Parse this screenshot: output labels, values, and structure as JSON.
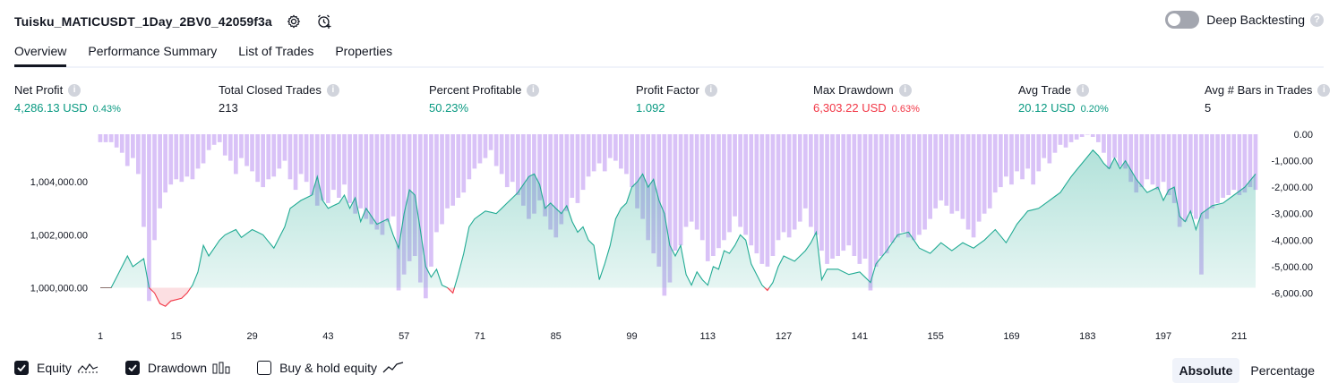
{
  "header": {
    "title": "Tuisku_MATICUSDT_1Day_2BV0_42059f3a",
    "deep_backtesting_label": "Deep Backtesting"
  },
  "tabs": [
    {
      "label": "Overview",
      "active": true
    },
    {
      "label": "Performance Summary",
      "active": false
    },
    {
      "label": "List of Trades",
      "active": false
    },
    {
      "label": "Properties",
      "active": false
    }
  ],
  "metrics": [
    {
      "label": "Net Profit",
      "value": "4,286.13 USD",
      "pct": "0.43%",
      "color": "green"
    },
    {
      "label": "Total Closed Trades",
      "value": "213",
      "pct": "",
      "color": "neutral"
    },
    {
      "label": "Percent Profitable",
      "value": "50.23%",
      "pct": "",
      "color": "green"
    },
    {
      "label": "Profit Factor",
      "value": "1.092",
      "pct": "",
      "color": "green"
    },
    {
      "label": "Max Drawdown",
      "value": "6,303.22 USD",
      "pct": "0.63%",
      "color": "red"
    },
    {
      "label": "Avg Trade",
      "value": "20.12 USD",
      "pct": "0.20%",
      "color": "green"
    },
    {
      "label": "Avg # Bars in Trades",
      "value": "5",
      "pct": "",
      "color": "neutral"
    }
  ],
  "legend": {
    "equity": {
      "label": "Equity",
      "checked": true
    },
    "drawdown": {
      "label": "Drawdown",
      "checked": true
    },
    "buy_hold": {
      "label": "Buy & hold equity",
      "checked": false
    }
  },
  "mode": {
    "absolute": "Absolute",
    "percentage": "Percentage",
    "active": "absolute"
  },
  "colors": {
    "equity_line": "#22ab94",
    "equity_fill": "#d7f0ea",
    "loss_line": "#f23645",
    "loss_fill": "#fcdfe2",
    "drawdown_bar": "#d9c2f7",
    "accent_green": "#089981",
    "accent_red": "#f23645"
  },
  "chart_data": {
    "type": "area",
    "x_ticks": [
      "1",
      "15",
      "29",
      "43",
      "57",
      "71",
      "85",
      "99",
      "113",
      "127",
      "141",
      "155",
      "169",
      "183",
      "197",
      "211"
    ],
    "y_left_ticks": [
      "1,000,000.00",
      "1,002,000.00",
      "1,004,000.00"
    ],
    "y_right_ticks": [
      "0.00",
      "-1,000.00",
      "-2,000.00",
      "-3,000.00",
      "-4,000.00",
      "-5,000.00",
      "-6,000.00"
    ],
    "y_left_range": [
      998800,
      1005800
    ],
    "y_right_range": [
      -7000,
      0
    ],
    "equity_keypoints": [
      [
        1,
        1000000
      ],
      [
        3,
        1000000
      ],
      [
        6,
        1001200
      ],
      [
        7,
        1000800
      ],
      [
        9,
        1001100
      ],
      [
        10,
        1000000
      ],
      [
        11,
        999800
      ],
      [
        12,
        999400
      ],
      [
        13,
        999300
      ],
      [
        14,
        999500
      ],
      [
        16,
        999600
      ],
      [
        17,
        999800
      ],
      [
        18,
        1000100
      ],
      [
        19,
        1000600
      ],
      [
        20,
        1001600
      ],
      [
        21,
        1001200
      ],
      [
        22,
        1001500
      ],
      [
        23,
        1001800
      ],
      [
        24,
        1002000
      ],
      [
        26,
        1002200
      ],
      [
        27,
        1001900
      ],
      [
        29,
        1002200
      ],
      [
        31,
        1002000
      ],
      [
        33,
        1001500
      ],
      [
        35,
        1002300
      ],
      [
        36,
        1003000
      ],
      [
        38,
        1003300
      ],
      [
        40,
        1003500
      ],
      [
        41,
        1004200
      ],
      [
        42,
        1003300
      ],
      [
        43,
        1003000
      ],
      [
        45,
        1003200
      ],
      [
        46,
        1003500
      ],
      [
        47,
        1003000
      ],
      [
        48,
        1003400
      ],
      [
        49,
        1002500
      ],
      [
        50,
        1003000
      ],
      [
        52,
        1002400
      ],
      [
        54,
        1002600
      ],
      [
        55,
        1002000
      ],
      [
        56,
        1001500
      ],
      [
        57,
        1002800
      ],
      [
        58,
        1003700
      ],
      [
        59,
        1003500
      ],
      [
        60,
        1002200
      ],
      [
        61,
        1000800
      ],
      [
        62,
        1000400
      ],
      [
        63,
        1000700
      ],
      [
        64,
        1000100
      ],
      [
        65,
        1000000
      ],
      [
        66,
        999800
      ],
      [
        67,
        1000500
      ],
      [
        68,
        1001300
      ],
      [
        69,
        1002300
      ],
      [
        70,
        1002600
      ],
      [
        72,
        1002900
      ],
      [
        74,
        1002800
      ],
      [
        76,
        1003200
      ],
      [
        78,
        1003600
      ],
      [
        80,
        1004200
      ],
      [
        81,
        1004300
      ],
      [
        82,
        1003900
      ],
      [
        83,
        1003000
      ],
      [
        84,
        1003200
      ],
      [
        86,
        1002800
      ],
      [
        87,
        1003100
      ],
      [
        88,
        1002500
      ],
      [
        89,
        1002100
      ],
      [
        90,
        1002300
      ],
      [
        91,
        1001800
      ],
      [
        92,
        1001600
      ],
      [
        93,
        1000300
      ],
      [
        94,
        1000900
      ],
      [
        95,
        1001600
      ],
      [
        96,
        1002600
      ],
      [
        97,
        1003000
      ],
      [
        98,
        1003200
      ],
      [
        99,
        1003800
      ],
      [
        100,
        1004000
      ],
      [
        101,
        1004300
      ],
      [
        102,
        1003800
      ],
      [
        103,
        1004100
      ],
      [
        104,
        1003300
      ],
      [
        105,
        1002800
      ],
      [
        106,
        1001600
      ],
      [
        107,
        1001200
      ],
      [
        108,
        1001600
      ],
      [
        109,
        1000500
      ],
      [
        110,
        1000100
      ],
      [
        111,
        1000600
      ],
      [
        112,
        1000300
      ],
      [
        113,
        1000100
      ],
      [
        114,
        1000800
      ],
      [
        115,
        1000700
      ],
      [
        116,
        1001400
      ],
      [
        117,
        1001300
      ],
      [
        118,
        1001600
      ],
      [
        119,
        1002000
      ],
      [
        120,
        1001800
      ],
      [
        121,
        1000900
      ],
      [
        122,
        1000500
      ],
      [
        123,
        1000100
      ],
      [
        124,
        999900
      ],
      [
        125,
        1000200
      ],
      [
        126,
        1000800
      ],
      [
        127,
        1001200
      ],
      [
        129,
        1001000
      ],
      [
        131,
        1001400
      ],
      [
        132,
        1001700
      ],
      [
        133,
        1002100
      ],
      [
        134,
        1000300
      ],
      [
        135,
        1000700
      ],
      [
        137,
        1000700
      ],
      [
        139,
        1000500
      ],
      [
        141,
        1000600
      ],
      [
        143,
        1000200
      ],
      [
        144,
        1000900
      ],
      [
        146,
        1001400
      ],
      [
        148,
        1002000
      ],
      [
        150,
        1002100
      ],
      [
        152,
        1001500
      ],
      [
        154,
        1001300
      ],
      [
        156,
        1001700
      ],
      [
        158,
        1001400
      ],
      [
        160,
        1001700
      ],
      [
        162,
        1001500
      ],
      [
        164,
        1001800
      ],
      [
        166,
        1002200
      ],
      [
        168,
        1001700
      ],
      [
        170,
        1002400
      ],
      [
        172,
        1002900
      ],
      [
        174,
        1003000
      ],
      [
        176,
        1003300
      ],
      [
        178,
        1003600
      ],
      [
        180,
        1004200
      ],
      [
        182,
        1004700
      ],
      [
        184,
        1005200
      ],
      [
        185,
        1005000
      ],
      [
        186,
        1004700
      ],
      [
        187,
        1004500
      ],
      [
        188,
        1004900
      ],
      [
        189,
        1004500
      ],
      [
        190,
        1004800
      ],
      [
        192,
        1004100
      ],
      [
        194,
        1003600
      ],
      [
        196,
        1003800
      ],
      [
        197,
        1003300
      ],
      [
        198,
        1003700
      ],
      [
        199,
        1003800
      ],
      [
        200,
        1002700
      ],
      [
        201,
        1002500
      ],
      [
        202,
        1002900
      ],
      [
        203,
        1002200
      ],
      [
        204,
        1002800
      ],
      [
        206,
        1003100
      ],
      [
        208,
        1003200
      ],
      [
        210,
        1003500
      ],
      [
        212,
        1003800
      ],
      [
        214,
        1004300
      ]
    ],
    "drawdown_keypoints": [
      [
        1,
        -300
      ],
      [
        3,
        -300
      ],
      [
        5,
        -700
      ],
      [
        6,
        -1200
      ],
      [
        7,
        -900
      ],
      [
        8,
        -1500
      ],
      [
        9,
        -3500
      ],
      [
        10,
        -6300
      ],
      [
        11,
        -4000
      ],
      [
        12,
        -2800
      ],
      [
        13,
        -2200
      ],
      [
        14,
        -1900
      ],
      [
        15,
        -1700
      ],
      [
        16,
        -1800
      ],
      [
        17,
        -1600
      ],
      [
        18,
        -1700
      ],
      [
        19,
        -1300
      ],
      [
        20,
        -1100
      ],
      [
        21,
        -600
      ],
      [
        22,
        -400
      ],
      [
        23,
        -300
      ],
      [
        24,
        -800
      ],
      [
        25,
        -1000
      ],
      [
        26,
        -1500
      ],
      [
        27,
        -900
      ],
      [
        28,
        -1200
      ],
      [
        29,
        -1400
      ],
      [
        30,
        -1800
      ],
      [
        31,
        -2000
      ],
      [
        32,
        -1700
      ],
      [
        33,
        -1600
      ],
      [
        34,
        -1300
      ],
      [
        35,
        -1000
      ],
      [
        36,
        -1700
      ],
      [
        37,
        -2100
      ],
      [
        38,
        -1500
      ],
      [
        39,
        -1800
      ],
      [
        40,
        -2300
      ],
      [
        41,
        -2700
      ],
      [
        42,
        -2500
      ],
      [
        43,
        -2600
      ],
      [
        44,
        -2100
      ],
      [
        45,
        -2400
      ],
      [
        46,
        -1900
      ],
      [
        47,
        -2600
      ],
      [
        48,
        -3000
      ],
      [
        49,
        -2800
      ],
      [
        50,
        -3200
      ],
      [
        51,
        -3400
      ],
      [
        52,
        -3600
      ],
      [
        53,
        -3800
      ],
      [
        54,
        -3300
      ],
      [
        55,
        -3100
      ],
      [
        56,
        -5900
      ],
      [
        57,
        -5300
      ],
      [
        58,
        -4800
      ],
      [
        59,
        -4600
      ],
      [
        60,
        -5600
      ],
      [
        61,
        -6200
      ],
      [
        62,
        -5000
      ],
      [
        63,
        -3700
      ],
      [
        64,
        -3400
      ],
      [
        65,
        -2800
      ],
      [
        66,
        -2700
      ],
      [
        67,
        -2400
      ],
      [
        68,
        -2200
      ],
      [
        69,
        -1700
      ],
      [
        70,
        -1300
      ],
      [
        71,
        -1100
      ],
      [
        72,
        -900
      ],
      [
        73,
        -600
      ],
      [
        74,
        -1200
      ],
      [
        75,
        -1500
      ],
      [
        76,
        -2000
      ],
      [
        77,
        -1800
      ],
      [
        78,
        -2300
      ],
      [
        79,
        -2700
      ],
      [
        80,
        -3200
      ],
      [
        81,
        -3000
      ],
      [
        82,
        -2500
      ],
      [
        83,
        -3100
      ],
      [
        84,
        -3600
      ],
      [
        85,
        -3900
      ],
      [
        86,
        -3400
      ],
      [
        87,
        -2900
      ],
      [
        88,
        -2400
      ],
      [
        89,
        -2600
      ],
      [
        90,
        -2100
      ],
      [
        91,
        -1600
      ],
      [
        92,
        -1400
      ],
      [
        93,
        -1100
      ],
      [
        94,
        -1400
      ],
      [
        95,
        -900
      ],
      [
        96,
        -1000
      ],
      [
        97,
        -1300
      ],
      [
        98,
        -1500
      ],
      [
        99,
        -2000
      ],
      [
        100,
        -2800
      ],
      [
        101,
        -3200
      ],
      [
        102,
        -4000
      ],
      [
        103,
        -4500
      ],
      [
        104,
        -5000
      ],
      [
        105,
        -6100
      ],
      [
        106,
        -5600
      ],
      [
        107,
        -4400
      ],
      [
        108,
        -4200
      ],
      [
        109,
        -3500
      ],
      [
        110,
        -3300
      ],
      [
        111,
        -3600
      ],
      [
        112,
        -4000
      ],
      [
        113,
        -4800
      ],
      [
        114,
        -4600
      ],
      [
        115,
        -4300
      ],
      [
        116,
        -4000
      ],
      [
        117,
        -3700
      ],
      [
        118,
        -3100
      ],
      [
        119,
        -3500
      ],
      [
        120,
        -3800
      ],
      [
        121,
        -4200
      ],
      [
        122,
        -4500
      ],
      [
        123,
        -4900
      ],
      [
        124,
        -5000
      ],
      [
        125,
        -4600
      ],
      [
        126,
        -4000
      ],
      [
        127,
        -3700
      ],
      [
        128,
        -3900
      ],
      [
        129,
        -3600
      ],
      [
        130,
        -3300
      ],
      [
        131,
        -2800
      ],
      [
        132,
        -3500
      ],
      [
        133,
        -3800
      ],
      [
        134,
        -4400
      ],
      [
        135,
        -4900
      ],
      [
        136,
        -4700
      ],
      [
        137,
        -4600
      ],
      [
        138,
        -4400
      ],
      [
        139,
        -4200
      ],
      [
        140,
        -4600
      ],
      [
        141,
        -4900
      ],
      [
        142,
        -4700
      ],
      [
        143,
        -5900
      ],
      [
        144,
        -5000
      ],
      [
        145,
        -4600
      ],
      [
        146,
        -4500
      ],
      [
        147,
        -4100
      ],
      [
        148,
        -3900
      ],
      [
        149,
        -3700
      ],
      [
        150,
        -3900
      ],
      [
        151,
        -4000
      ],
      [
        152,
        -3800
      ],
      [
        153,
        -3600
      ],
      [
        154,
        -3200
      ],
      [
        155,
        -2800
      ],
      [
        156,
        -2500
      ],
      [
        157,
        -2700
      ],
      [
        158,
        -3000
      ],
      [
        159,
        -2900
      ],
      [
        160,
        -3200
      ],
      [
        161,
        -3600
      ],
      [
        162,
        -3900
      ],
      [
        163,
        -3300
      ],
      [
        164,
        -3000
      ],
      [
        165,
        -2800
      ],
      [
        166,
        -2200
      ],
      [
        167,
        -2000
      ],
      [
        168,
        -1600
      ],
      [
        169,
        -1900
      ],
      [
        170,
        -1400
      ],
      [
        171,
        -1700
      ],
      [
        172,
        -1300
      ],
      [
        173,
        -1900
      ],
      [
        174,
        -1400
      ],
      [
        175,
        -900
      ],
      [
        176,
        -1100
      ],
      [
        177,
        -700
      ],
      [
        178,
        -400
      ],
      [
        179,
        -500
      ],
      [
        180,
        -300
      ],
      [
        181,
        -200
      ],
      [
        182,
        -100
      ],
      [
        183,
        0
      ],
      [
        184,
        -100
      ],
      [
        185,
        -300
      ],
      [
        186,
        -700
      ],
      [
        187,
        -1300
      ],
      [
        188,
        -900
      ],
      [
        189,
        -1200
      ],
      [
        190,
        -1300
      ],
      [
        191,
        -1800
      ],
      [
        192,
        -2200
      ],
      [
        193,
        -2000
      ],
      [
        194,
        -1700
      ],
      [
        195,
        -1900
      ],
      [
        196,
        -2100
      ],
      [
        197,
        -1800
      ],
      [
        198,
        -2300
      ],
      [
        199,
        -2600
      ],
      [
        200,
        -3500
      ],
      [
        201,
        -3300
      ],
      [
        202,
        -3000
      ],
      [
        203,
        -3200
      ],
      [
        204,
        -5300
      ],
      [
        205,
        -3200
      ],
      [
        206,
        -2800
      ],
      [
        207,
        -2600
      ],
      [
        208,
        -2400
      ],
      [
        209,
        -2300
      ],
      [
        210,
        -2100
      ],
      [
        211,
        -2300
      ],
      [
        212,
        -2200
      ],
      [
        213,
        -2000
      ],
      [
        214,
        -2100
      ]
    ]
  }
}
